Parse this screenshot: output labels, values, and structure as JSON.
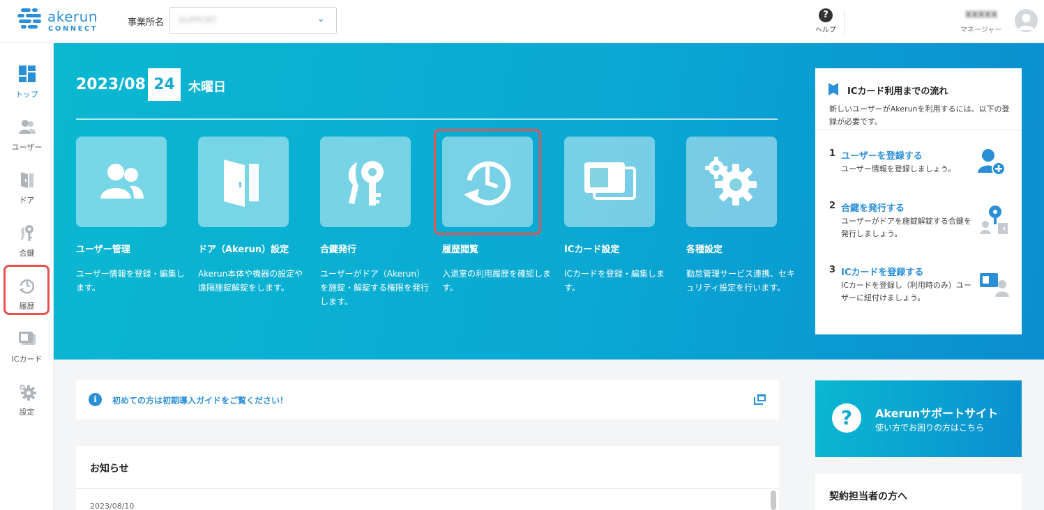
{
  "header": {
    "logo_name": "akerun",
    "logo_sub": "CONNECT",
    "office_label": "事業所名",
    "office_value": "SUPPORT",
    "help_label": "ヘルプ",
    "user_name": "XXXXX",
    "user_role": "マネージャー"
  },
  "sidebar": {
    "items": [
      {
        "label": "トップ",
        "icon": "dashboard-icon",
        "active": true
      },
      {
        "label": "ユーザー",
        "icon": "users-icon"
      },
      {
        "label": "ドア",
        "icon": "door-icon"
      },
      {
        "label": "合鍵",
        "icon": "key-icon"
      },
      {
        "label": "履歴",
        "icon": "history-icon",
        "highlighted": true
      },
      {
        "label": "ICカード",
        "icon": "ic-card-icon"
      },
      {
        "label": "設定",
        "icon": "gear-icon"
      }
    ]
  },
  "hero": {
    "year_month": "2023/08",
    "day": "24",
    "weekday": "木曜日",
    "tiles": [
      {
        "title": "ユーザー管理",
        "desc": "ユーザー情報を登録・編集します。",
        "icon": "users-icon"
      },
      {
        "title": "ドア（Akerun）設定",
        "desc": "Akerun本体や機器の設定や遠隔施錠解錠をします。",
        "icon": "door-icon"
      },
      {
        "title": "合鍵発行",
        "desc": "ユーザーがドア（Akerun）を施錠・解錠する権限を発行します。",
        "icon": "key-icon"
      },
      {
        "title": "履歴閲覧",
        "desc": "入退室の利用履歴を確認します。",
        "icon": "history-icon",
        "highlighted": true
      },
      {
        "title": "ICカード設定",
        "desc": "ICカードを登録・編集します。",
        "icon": "ic-card-icon"
      },
      {
        "title": "各種設定",
        "desc": "勤怠管理サービス連携、セキュリティ設定を行います。",
        "icon": "gear-icon"
      }
    ]
  },
  "flow": {
    "title": "ICカード利用までの流れ",
    "desc": "新しいユーザーがAkerunを利用するには、以下の登録が必要です。",
    "steps": [
      {
        "num": "1",
        "title": "ユーザーを登録する",
        "desc": "ユーザー情報を登録しましょう。",
        "icon": "add-user-icon"
      },
      {
        "num": "2",
        "title": "合鍵を発行する",
        "desc": "ユーザーがドアを施錠解錠する合鍵を発行しましょう。",
        "icon": "key-door-icon"
      },
      {
        "num": "3",
        "title": "ICカードを登録する",
        "desc": "ICカードを登録し（利用時のみ）ユーザーに紐付けましょう。",
        "icon": "card-user-icon"
      }
    ]
  },
  "guide": {
    "text": "初めての方は初期導入ガイドをご覧ください！"
  },
  "news": {
    "title": "お知らせ",
    "first_date": "2023/08/10"
  },
  "support": {
    "title": "Akerunサポートサイト",
    "sub": "使い方でお困りの方はこちら"
  },
  "contract": {
    "title": "契約担当者の方へ"
  },
  "colors": {
    "brand": "#2a8fd6",
    "hero_start": "#0ab8d1",
    "hero_end": "#0b8ed0",
    "highlight": "#e5524f"
  }
}
